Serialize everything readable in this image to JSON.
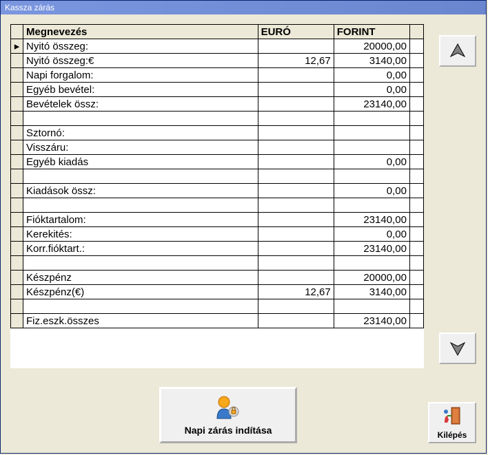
{
  "window": {
    "title": "Kassza zárás"
  },
  "columns": {
    "name": "Megnevezés",
    "euro": "EURÓ",
    "forint": "FORINT"
  },
  "rows": [
    {
      "marker": "▸",
      "name": "Nyitó összeg:",
      "euro": "",
      "forint": "20000,00"
    },
    {
      "marker": "",
      "name": "Nyitó összeg:€",
      "euro": "12,67",
      "forint": "3140,00"
    },
    {
      "marker": "",
      "name": "Napi forgalom:",
      "euro": "",
      "forint": "0,00"
    },
    {
      "marker": "",
      "name": "Egyéb bevétel:",
      "euro": "",
      "forint": "0,00"
    },
    {
      "marker": "",
      "name": "Bevételek össz:",
      "euro": "",
      "forint": "23140,00"
    },
    {
      "marker": "",
      "name": "",
      "euro": "",
      "forint": ""
    },
    {
      "marker": "",
      "name": "Sztornó:",
      "euro": "",
      "forint": ""
    },
    {
      "marker": "",
      "name": "Visszáru:",
      "euro": "",
      "forint": ""
    },
    {
      "marker": "",
      "name": "Egyéb kiadás",
      "euro": "",
      "forint": "0,00"
    },
    {
      "marker": "",
      "name": "",
      "euro": "",
      "forint": ""
    },
    {
      "marker": "",
      "name": "Kiadások össz:",
      "euro": "",
      "forint": "0,00"
    },
    {
      "marker": "",
      "name": "",
      "euro": "",
      "forint": ""
    },
    {
      "marker": "",
      "name": "Fióktartalom:",
      "euro": "",
      "forint": "23140,00"
    },
    {
      "marker": "",
      "name": "Kerekités:",
      "euro": "",
      "forint": "0,00"
    },
    {
      "marker": "",
      "name": "Korr.fióktart.:",
      "euro": "",
      "forint": "23140,00"
    },
    {
      "marker": "",
      "name": "",
      "euro": "",
      "forint": ""
    },
    {
      "marker": "",
      "name": "Készpénz",
      "euro": "",
      "forint": "20000,00"
    },
    {
      "marker": "",
      "name": "Készpénz(€)",
      "euro": "12,67",
      "forint": "3140,00"
    },
    {
      "marker": "",
      "name": "",
      "euro": "",
      "forint": ""
    },
    {
      "marker": "",
      "name": "Fiz.eszk.összes",
      "euro": "",
      "forint": "23140,00"
    }
  ],
  "buttons": {
    "main": "Napi zárás indítása",
    "exit": "Kilépés"
  }
}
